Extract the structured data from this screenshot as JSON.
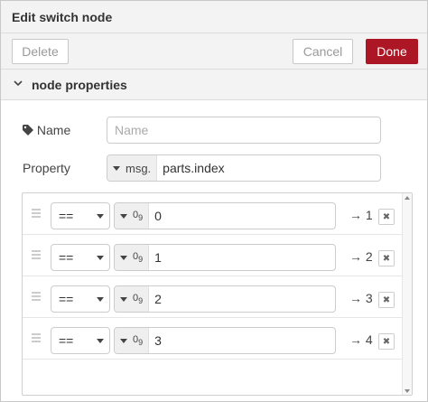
{
  "dialog": {
    "title": "Edit switch node"
  },
  "toolbar": {
    "delete_label": "Delete",
    "cancel_label": "Cancel",
    "done_label": "Done"
  },
  "section": {
    "label": "node properties",
    "chevron": "chevron-down-icon"
  },
  "name_field": {
    "label": "Name",
    "icon": "tag-icon",
    "placeholder": "Name",
    "value": ""
  },
  "property_field": {
    "label": "Property",
    "type_prefix": "msg.",
    "value": "parts.index"
  },
  "rules": [
    {
      "operator": "==",
      "type_icon": "number-icon",
      "value": "0",
      "output": "→ 1"
    },
    {
      "operator": "==",
      "type_icon": "number-icon",
      "value": "1",
      "output": "→ 2"
    },
    {
      "operator": "==",
      "type_icon": "number-icon",
      "value": "2",
      "output": "→ 3"
    },
    {
      "operator": "==",
      "type_icon": "number-icon",
      "value": "3",
      "output": "→ 4"
    }
  ],
  "number_type_glyph": "0",
  "number_type_sub": "9",
  "remove_glyph": "✖",
  "colors": {
    "done_button": "#ad1625",
    "header_bg": "#f3f3f3"
  }
}
